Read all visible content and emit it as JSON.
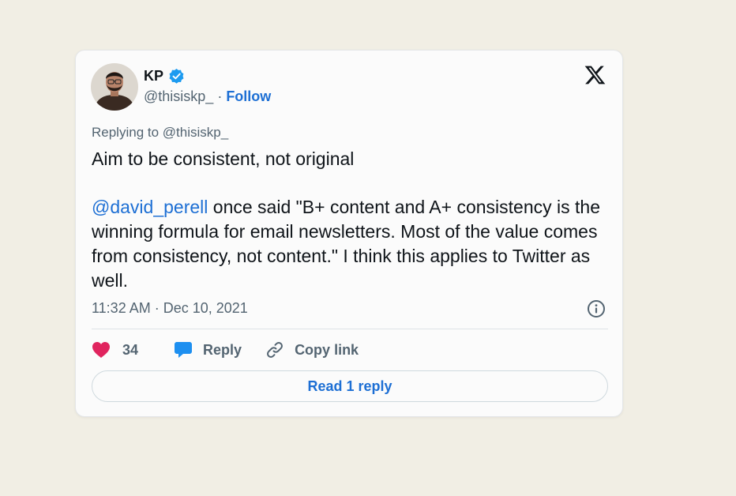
{
  "author": {
    "name": "KP",
    "handle": "@thisiskp_",
    "separator": "·",
    "follow_label": "Follow",
    "verified": true
  },
  "tweet": {
    "replying_to": "Replying to @thisiskp_",
    "line1": "Aim to be consistent, not original",
    "mention": "@david_perell",
    "body": " once said \"B+ content and A+ consistency is the winning formula for email newsletters. Most of the value comes from consistency, not content.\" I think this applies to Twitter as well.",
    "timestamp": "11:32 AM · Dec 10, 2021"
  },
  "actions": {
    "like_count": "34",
    "reply_label": "Reply",
    "copy_link_label": "Copy link"
  },
  "read_replies_label": "Read 1 reply",
  "colors": {
    "page_background": "#f1eee4",
    "card_background": "#fbfbfb",
    "link_blue": "#1d6fd4",
    "heart_pink": "#e0245e",
    "verified_blue": "#1d9bf0",
    "muted_text": "#536471"
  },
  "icons": {
    "verified": "verified-badge-icon",
    "brand": "x-logo-icon",
    "info": "info-icon",
    "like": "heart-icon",
    "reply": "speech-bubble-icon",
    "copy": "link-icon"
  }
}
